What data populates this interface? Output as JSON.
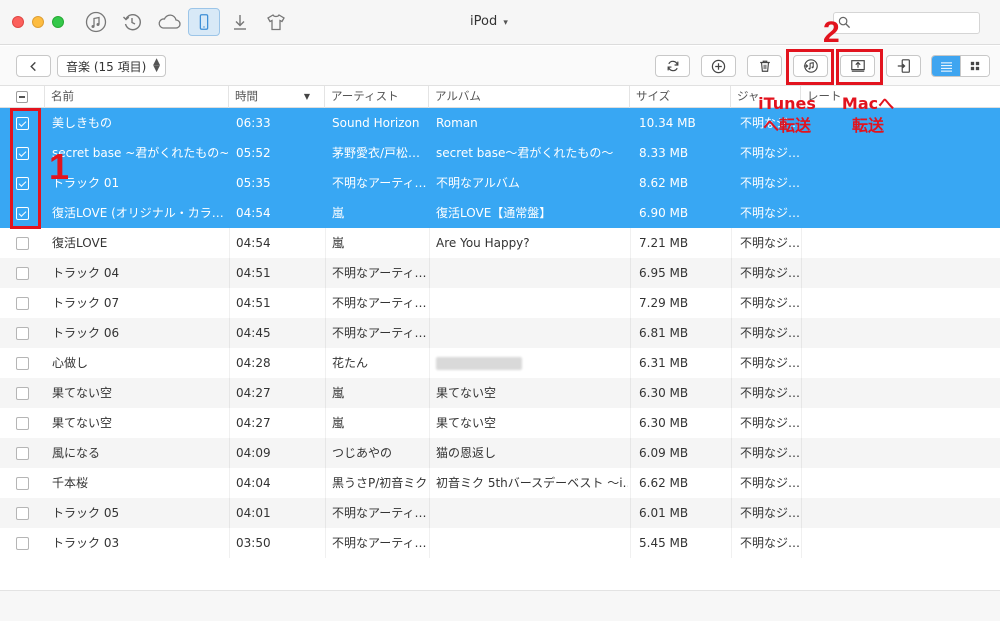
{
  "window": {
    "title": "iPod"
  },
  "top_icons": [
    "music-icon",
    "restore-icon",
    "cloud-icon",
    "device-icon",
    "download-icon",
    "tshirt-icon"
  ],
  "toolbar": {
    "category_label": "音楽 (15 項目)"
  },
  "annotations": {
    "step1": "1",
    "step2": "2",
    "itunes_label_line1": "iTunes",
    "itunes_label_line2": "へ転送",
    "mac_label_line1": "Macへ",
    "mac_label_line2": "転送"
  },
  "table": {
    "columns": {
      "name": "名前",
      "time": "時間",
      "artist": "アーティスト",
      "album": "アルバム",
      "size": "サイズ",
      "genre": "ジャ",
      "rating": "レート"
    },
    "rows": [
      {
        "selected": true,
        "name": "美しきもの",
        "time": "06:33",
        "artist": "Sound Horizon",
        "album": "Roman",
        "size": "10.34 MB",
        "genre": "不明なジ…"
      },
      {
        "selected": true,
        "name": "secret base ~君がくれたもの~…",
        "time": "05:52",
        "artist": "茅野愛衣/戸松…",
        "album": "secret base〜君がくれたもの〜",
        "size": "8.33 MB",
        "genre": "不明なジ…"
      },
      {
        "selected": true,
        "name": "トラック 01",
        "time": "05:35",
        "artist": "不明なアーティ…",
        "album": "不明なアルバム",
        "size": "8.62 MB",
        "genre": "不明なジ…"
      },
      {
        "selected": true,
        "name": "復活LOVE (オリジナル・カラ…",
        "time": "04:54",
        "artist": "嵐",
        "album": "復活LOVE【通常盤】",
        "size": "6.90 MB",
        "genre": "不明なジ…"
      },
      {
        "selected": false,
        "name": "復活LOVE",
        "time": "04:54",
        "artist": "嵐",
        "album": "Are You Happy?",
        "size": "7.21 MB",
        "genre": "不明なジ…"
      },
      {
        "selected": false,
        "name": "トラック 04",
        "time": "04:51",
        "artist": "不明なアーティ…",
        "album": "",
        "size": "6.95 MB",
        "genre": "不明なジ…"
      },
      {
        "selected": false,
        "name": "トラック 07",
        "time": "04:51",
        "artist": "不明なアーティ…",
        "album": "",
        "size": "7.29 MB",
        "genre": "不明なジ…"
      },
      {
        "selected": false,
        "name": "トラック 06",
        "time": "04:45",
        "artist": "不明なアーティ…",
        "album": "",
        "size": "6.81 MB",
        "genre": "不明なジ…"
      },
      {
        "selected": false,
        "name": "心做し",
        "time": "04:28",
        "artist": "花たん",
        "album": "",
        "album_blurred": true,
        "size": "6.31 MB",
        "genre": "不明なジ…"
      },
      {
        "selected": false,
        "name": "果てない空",
        "time": "04:27",
        "artist": "嵐",
        "album": "果てない空",
        "size": "6.30 MB",
        "genre": "不明なジ…"
      },
      {
        "selected": false,
        "name": "果てない空",
        "time": "04:27",
        "artist": "嵐",
        "album": "果てない空",
        "size": "6.30 MB",
        "genre": "不明なジ…"
      },
      {
        "selected": false,
        "name": "風になる",
        "time": "04:09",
        "artist": "つじあやの",
        "album": "猫の恩返し",
        "size": "6.09 MB",
        "genre": "不明なジ…"
      },
      {
        "selected": false,
        "name": "千本桜",
        "time": "04:04",
        "artist": "黒うさP/初音ミク",
        "album": "初音ミク 5thバースデーベスト 〜i…",
        "size": "6.62 MB",
        "genre": "不明なジ…"
      },
      {
        "selected": false,
        "name": "トラック 05",
        "time": "04:01",
        "artist": "不明なアーティ…",
        "album": "",
        "size": "6.01 MB",
        "genre": "不明なジ…"
      },
      {
        "selected": false,
        "name": "トラック 03",
        "time": "03:50",
        "artist": "不明なアーティ…",
        "album": "",
        "size": "5.45 MB",
        "genre": "不明なジ…"
      }
    ]
  },
  "colors": {
    "selection": "#38a7f3",
    "annotation_red": "#e2131e",
    "view_active": "#3fa5f0"
  }
}
